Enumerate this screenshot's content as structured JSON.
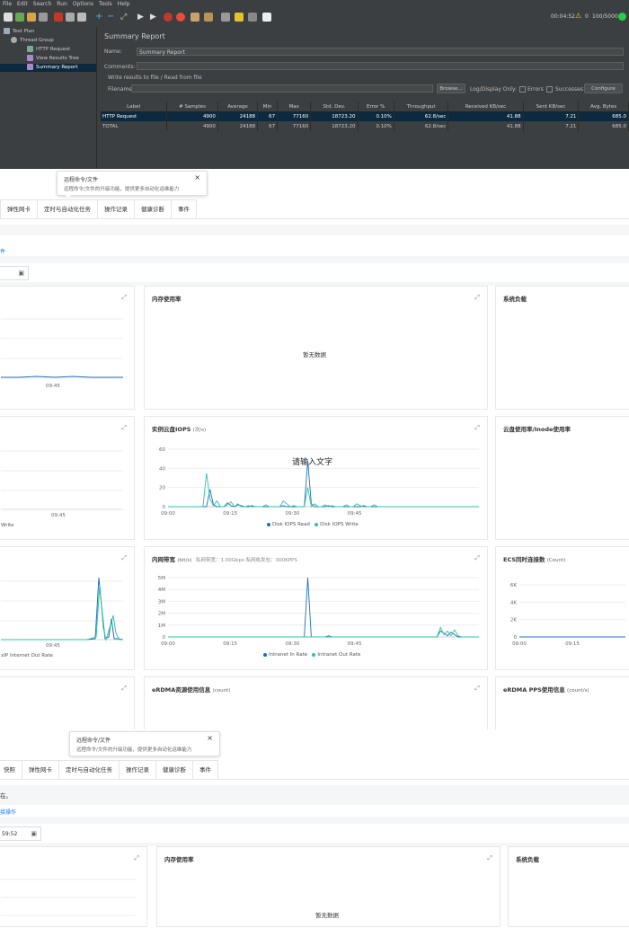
{
  "jmeter": {
    "menu": [
      "File",
      "Edit",
      "Search",
      "Run",
      "Options",
      "Tools",
      "Help"
    ],
    "timer": "00:04:52",
    "warn_count": "0",
    "threads": "100/5000",
    "tree": [
      {
        "label": "Test Plan"
      },
      {
        "label": "Thread Group"
      },
      {
        "label": "HTTP Request"
      },
      {
        "label": "View Results Tree"
      },
      {
        "label": "Summary Report"
      }
    ],
    "panel_title": "Summary Report",
    "name_label": "Name:",
    "name_value": "Summary Report",
    "comments_label": "Comments:",
    "write_results_label": "Write results to file / Read from file",
    "filename_label": "Filename",
    "browse_label": "Browse...",
    "log_display_label": "Log/Display Only:",
    "errors_label": "Errors",
    "successes_label": "Successes",
    "configure_label": "Configure",
    "columns": [
      "Label",
      "# Samples",
      "Average",
      "Min",
      "Max",
      "Std. Dev.",
      "Error %",
      "Throughput",
      "Received KB/sec",
      "Sent KB/sec",
      "Avg. Bytes"
    ],
    "rows": [
      [
        "HTTP Request",
        "4900",
        "24188",
        "67",
        "77160",
        "18723.20",
        "0.10%",
        "62.8/sec",
        "41.88",
        "7.21",
        "685.0"
      ],
      [
        "TOTAL",
        "4900",
        "24188",
        "67",
        "77160",
        "18723.20",
        "0.10%",
        "62.8/sec",
        "41.88",
        "7.21",
        "685.0"
      ]
    ]
  },
  "console": {
    "tooltip_title": "远程命令/文件",
    "tooltip_desc": "远程命令/文件的升级功能，提供更多自动化运维能力",
    "tabs": [
      "弹性网卡",
      "定时与自动化任务",
      "操作记录",
      "健康诊断",
      "事件"
    ],
    "link_fragment": "件",
    "cards": {
      "memory": {
        "title": "内存使用率",
        "nodata": "暂无数据"
      },
      "load": {
        "title": "系统负载"
      },
      "iops": {
        "title": "实例云盘IOPS",
        "unit": "(次/s)",
        "overlay": "请输入文字",
        "legend": [
          "Disk IOPS Read",
          "Disk IOPS Write"
        ]
      },
      "inode": {
        "title": "云盘使用率/Inode使用率"
      },
      "intranet": {
        "title": "内网带宽",
        "unit": "(bit/s)",
        "note": "私网带宽：1.00Gbps 私网收发包：300KPPS",
        "legend": [
          "Intranet In Rate",
          "Intranet Out Rate"
        ]
      },
      "ecs_conn": {
        "title": "ECS同时连接数",
        "unit": "(Count)"
      },
      "erdma": {
        "title": "eRDMA资源使用信息",
        "unit": "(count)"
      },
      "erdma_pps": {
        "title": "eRDMA PPS使用信息",
        "unit": "(count/s)"
      }
    },
    "left_labels": {
      "write": "Write",
      "out_rate": "xIP Internet Out Rate",
      "t1": "09:45",
      "t2": "09:45",
      "t3": "09:45"
    },
    "tabs2": [
      "快照",
      "弹性网卡",
      "定时与自动化任务",
      "操作记录",
      "健康诊断",
      "事件"
    ],
    "notice_fragment": "在。",
    "link_fragment2": "接操作",
    "date_fragment": "59:52",
    "cards2": {
      "memory": {
        "title": "内存使用率",
        "nodata": "暂无数据"
      },
      "load": {
        "title": "系统负载"
      }
    }
  },
  "chart_data": [
    {
      "type": "line",
      "title": "实例云盘IOPS",
      "x_ticks": [
        "09:00",
        "09:15",
        "09:30",
        "09:45"
      ],
      "y_ticks": [
        0,
        20,
        40,
        60
      ],
      "ylim": [
        0,
        60
      ],
      "series": [
        {
          "name": "Disk IOPS Read",
          "color": "#1f6fbf",
          "values": [
            0,
            0,
            0,
            0,
            0,
            0,
            0,
            0,
            0,
            0,
            0,
            0,
            18,
            2,
            0,
            0,
            0,
            4,
            1,
            0,
            2,
            1,
            0,
            0,
            1,
            0,
            0,
            0,
            0,
            0,
            0,
            0,
            0,
            1,
            0,
            0,
            0,
            0,
            0,
            0,
            48,
            3,
            0,
            0,
            0,
            0,
            1,
            0,
            0,
            0,
            0,
            0,
            0,
            0,
            0,
            0,
            1,
            0,
            0,
            0,
            0,
            0,
            0,
            0,
            0,
            0,
            0,
            0,
            0,
            0,
            0,
            0,
            0,
            0,
            0,
            0,
            0,
            0,
            0,
            0,
            0,
            0,
            0,
            0,
            0,
            0,
            0,
            0,
            0,
            0
          ]
        },
        {
          "name": "Disk IOPS Write",
          "color": "#2ec4a0",
          "values": [
            0,
            0,
            0,
            0,
            0,
            0,
            0,
            0,
            0,
            0,
            0,
            35,
            8,
            1,
            6,
            0,
            0,
            2,
            5,
            0,
            3,
            0,
            0,
            1,
            0,
            0,
            0,
            0,
            2,
            0,
            0,
            0,
            0,
            6,
            3,
            0,
            1,
            0,
            0,
            0,
            20,
            0,
            3,
            0,
            0,
            2,
            0,
            1,
            0,
            0,
            0,
            2,
            0,
            0,
            3,
            1,
            0,
            0,
            0,
            2,
            0,
            0,
            0,
            0,
            0,
            0,
            0,
            0,
            0,
            0,
            0,
            0,
            0,
            0,
            0,
            0,
            0,
            0,
            0,
            0,
            0,
            0,
            0,
            0,
            0,
            0,
            0,
            0,
            0,
            0
          ]
        }
      ]
    },
    {
      "type": "line",
      "title": "内网带宽",
      "x_ticks": [
        "09:00",
        "09:15",
        "09:30",
        "09:45"
      ],
      "y_ticks": [
        "0",
        "1M",
        "2M",
        "3M",
        "4M",
        "5M"
      ],
      "ylim": [
        0,
        5
      ],
      "series": [
        {
          "name": "Intranet In Rate",
          "color": "#1f6fbf",
          "values": [
            0,
            0,
            0,
            0,
            0,
            0,
            0,
            0,
            0,
            0,
            0,
            0,
            0,
            0,
            0,
            0,
            0,
            0,
            0,
            0,
            0,
            0,
            0,
            0,
            0,
            0,
            0,
            0,
            0,
            0,
            0,
            0,
            0,
            0,
            0,
            0,
            0,
            0,
            0,
            0,
            5,
            0,
            0,
            0,
            0,
            0,
            0.1,
            0,
            0,
            0,
            0,
            0,
            0,
            0,
            0,
            0,
            0,
            0,
            0,
            0,
            0,
            0,
            0,
            0,
            0,
            0,
            0,
            0,
            0,
            0,
            0,
            0,
            0,
            0,
            0,
            0,
            0,
            0,
            0.5,
            0.3,
            0.1,
            0.4,
            0.2,
            0,
            0,
            0,
            0,
            0,
            0,
            0
          ]
        },
        {
          "name": "Intranet Out Rate",
          "color": "#2ec4a0",
          "values": [
            0,
            0,
            0,
            0,
            0,
            0,
            0,
            0,
            0,
            0,
            0,
            0,
            0,
            0,
            0,
            0,
            0,
            0,
            0,
            0,
            0,
            0,
            0,
            0,
            0,
            0,
            0,
            0,
            0,
            0,
            0,
            0,
            0,
            0,
            0,
            0,
            0,
            0,
            0,
            0,
            0,
            0,
            0,
            0,
            0,
            0,
            0,
            0,
            0,
            0,
            0,
            0,
            0,
            0,
            0,
            0,
            0,
            0,
            0,
            0,
            0,
            0,
            0,
            0,
            0,
            0,
            0,
            0,
            0,
            0,
            0,
            0,
            0,
            0,
            0,
            0,
            0,
            0,
            0.8,
            0.2,
            0.5,
            0.1,
            0.6,
            0.1,
            0,
            0,
            0,
            0,
            0,
            0
          ]
        }
      ]
    },
    {
      "type": "line",
      "title": "ECS同时连接数",
      "x_ticks": [
        "09:00",
        "09:15"
      ],
      "y_ticks": [
        "0",
        "2K",
        "4K",
        "6K"
      ],
      "ylim": [
        0,
        6
      ],
      "series": [
        {
          "name": "",
          "color": "#1f6fbf",
          "values": [
            0,
            0,
            0,
            0,
            0,
            0,
            0,
            0,
            0,
            0,
            0,
            0,
            0,
            0,
            0,
            0,
            0,
            0,
            0,
            0,
            0
          ]
        }
      ]
    }
  ]
}
